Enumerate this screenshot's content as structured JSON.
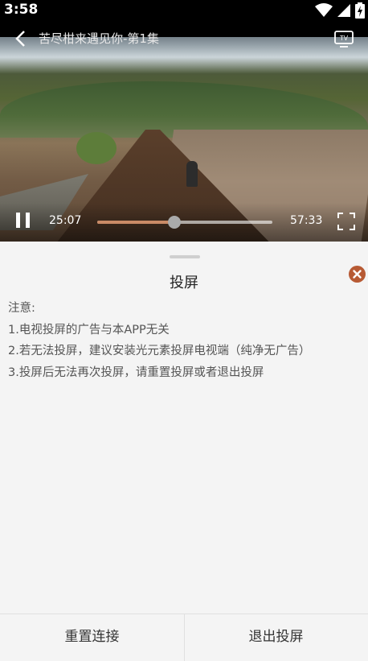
{
  "status_bar": {
    "time": "3:58",
    "icons": [
      "wifi-icon",
      "signal-icon",
      "battery-charging-icon"
    ]
  },
  "player": {
    "title": "苦尽柑来遇见你-第1集",
    "current_time": "25:07",
    "total_time": "57:33",
    "progress_fraction": 0.44,
    "state": "playing",
    "accent_color": "#c98a66",
    "icons": [
      "back-arrow-icon",
      "tv-cast-icon",
      "pause-icon",
      "fullscreen-icon"
    ]
  },
  "cast_panel": {
    "title": "投屏",
    "notice_heading": "注意:",
    "notes": [
      "1.电视投屏的广告与本APP无关",
      "2.若无法投屏，建议安装光元素投屏电视端（纯净无广告）",
      "3.投屏后无法再次投屏，请重置投屏或者退出投屏"
    ],
    "close_icon": "close-circle-icon",
    "close_color": "#b75a34"
  },
  "bottom_actions": {
    "reset_label": "重置连接",
    "exit_label": "退出投屏"
  }
}
